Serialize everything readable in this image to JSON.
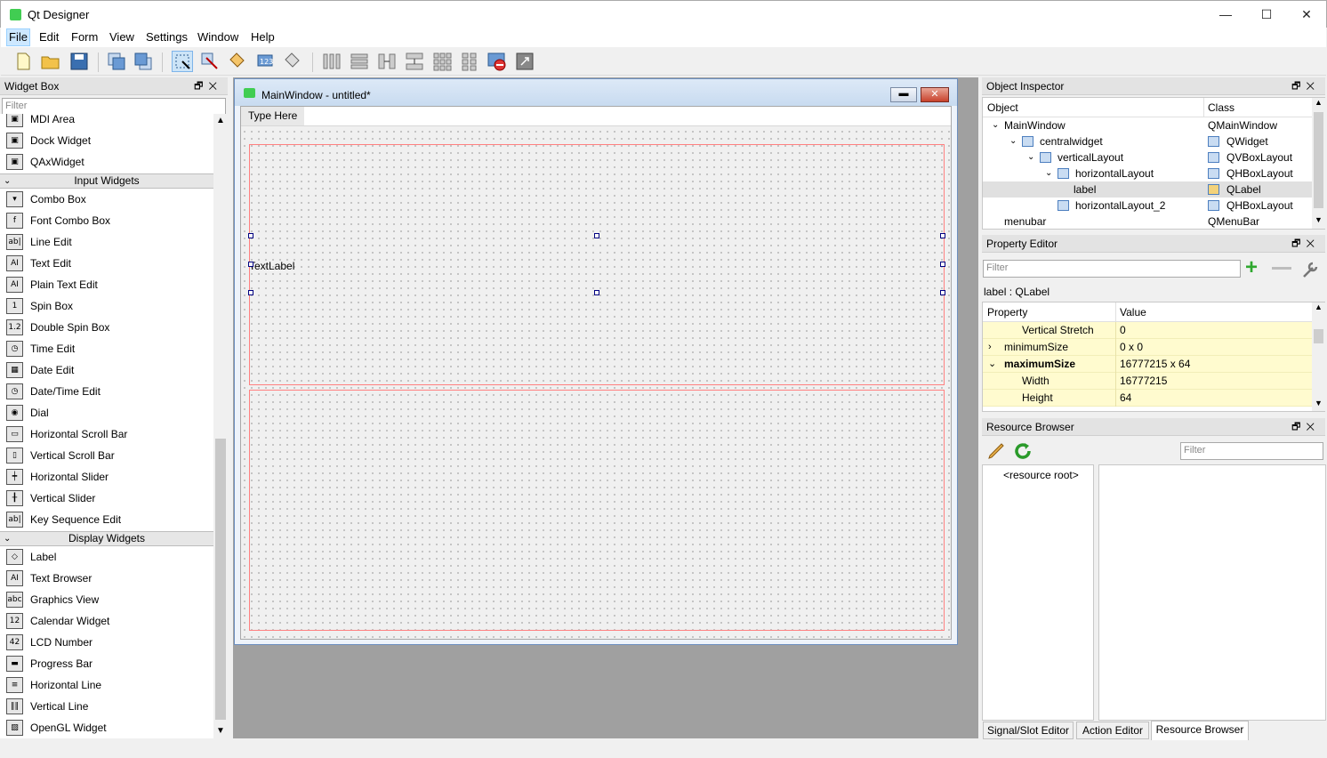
{
  "app": {
    "title": "Qt Designer",
    "minimize": "—",
    "maximize": "☐",
    "close": "✕"
  },
  "menu": [
    "File",
    "Edit",
    "Form",
    "View",
    "Settings",
    "Window",
    "Help"
  ],
  "widget_box": {
    "title": "Widget Box",
    "filter_placeholder": "Filter",
    "items_top": [
      {
        "label": "MDI Area",
        "icon": "mdi-area-icon"
      },
      {
        "label": "Dock Widget",
        "icon": "dock-widget-icon"
      },
      {
        "label": "QAxWidget",
        "icon": "qaxwidget-icon"
      }
    ],
    "cat_input": "Input Widgets",
    "input_items": [
      {
        "label": "Combo Box",
        "icon": "combo-box-icon",
        "glyph": "▾"
      },
      {
        "label": "Font Combo Box",
        "icon": "font-combo-box-icon",
        "glyph": "f"
      },
      {
        "label": "Line Edit",
        "icon": "line-edit-icon",
        "glyph": "ab|"
      },
      {
        "label": "Text Edit",
        "icon": "text-edit-icon",
        "glyph": "AI"
      },
      {
        "label": "Plain Text Edit",
        "icon": "plain-text-edit-icon",
        "glyph": "AI"
      },
      {
        "label": "Spin Box",
        "icon": "spin-box-icon",
        "glyph": "1"
      },
      {
        "label": "Double Spin Box",
        "icon": "double-spin-box-icon",
        "glyph": "1.2"
      },
      {
        "label": "Time Edit",
        "icon": "time-edit-icon",
        "glyph": "◷"
      },
      {
        "label": "Date Edit",
        "icon": "date-edit-icon",
        "glyph": "▦"
      },
      {
        "label": "Date/Time Edit",
        "icon": "date-time-edit-icon",
        "glyph": "◷"
      },
      {
        "label": "Dial",
        "icon": "dial-icon",
        "glyph": "◉"
      },
      {
        "label": "Horizontal Scroll Bar",
        "icon": "horizontal-scroll-bar-icon",
        "glyph": "▭"
      },
      {
        "label": "Vertical Scroll Bar",
        "icon": "vertical-scroll-bar-icon",
        "glyph": "▯"
      },
      {
        "label": "Horizontal Slider",
        "icon": "horizontal-slider-icon",
        "glyph": "┿"
      },
      {
        "label": "Vertical Slider",
        "icon": "vertical-slider-icon",
        "glyph": "╂"
      },
      {
        "label": "Key Sequence Edit",
        "icon": "key-sequence-edit-icon",
        "glyph": "ab|"
      }
    ],
    "cat_display": "Display Widgets",
    "display_items": [
      {
        "label": "Label",
        "icon": "label-icon",
        "glyph": "◇"
      },
      {
        "label": "Text Browser",
        "icon": "text-browser-icon",
        "glyph": "AI"
      },
      {
        "label": "Graphics View",
        "icon": "graphics-view-icon",
        "glyph": "abc"
      },
      {
        "label": "Calendar Widget",
        "icon": "calendar-widget-icon",
        "glyph": "12"
      },
      {
        "label": "LCD Number",
        "icon": "lcd-number-icon",
        "glyph": "42"
      },
      {
        "label": "Progress Bar",
        "icon": "progress-bar-icon",
        "glyph": "▬"
      },
      {
        "label": "Horizontal Line",
        "icon": "horizontal-line-icon",
        "glyph": "≡"
      },
      {
        "label": "Vertical Line",
        "icon": "vertical-line-icon",
        "glyph": "‖‖"
      },
      {
        "label": "OpenGL Widget",
        "icon": "opengl-widget-icon",
        "glyph": "▨"
      }
    ]
  },
  "form": {
    "title": "MainWindow - untitled*",
    "type_here": "Type Here",
    "text_label": "TextLabel"
  },
  "object_inspector": {
    "title": "Object Inspector",
    "col_object": "Object",
    "col_class": "Class",
    "rows": [
      {
        "object": "MainWindow",
        "class": "QMainWindow"
      },
      {
        "object": "centralwidget",
        "class": "QWidget"
      },
      {
        "object": "verticalLayout",
        "class": "QVBoxLayout"
      },
      {
        "object": "horizontalLayout",
        "class": "QHBoxLayout"
      },
      {
        "object": "label",
        "class": "QLabel"
      },
      {
        "object": "horizontalLayout_2",
        "class": "QHBoxLayout"
      },
      {
        "object": "menubar",
        "class": "QMenuBar"
      }
    ]
  },
  "property_editor": {
    "title": "Property Editor",
    "filter_placeholder": "Filter",
    "context": "label : QLabel",
    "col_property": "Property",
    "col_value": "Value",
    "rows": [
      {
        "name": "Vertical Stretch",
        "value": "0"
      },
      {
        "name": "minimumSize",
        "value": "0 x 0"
      },
      {
        "name": "maximumSize",
        "value": "16777215 x 64"
      },
      {
        "name": "Width",
        "value": "16777215"
      },
      {
        "name": "Height",
        "value": "64"
      }
    ]
  },
  "resource_browser": {
    "title": "Resource Browser",
    "filter_placeholder": "Filter",
    "root": "<resource root>"
  },
  "tabs": [
    "Signal/Slot Editor",
    "Action Editor",
    "Resource Browser"
  ]
}
